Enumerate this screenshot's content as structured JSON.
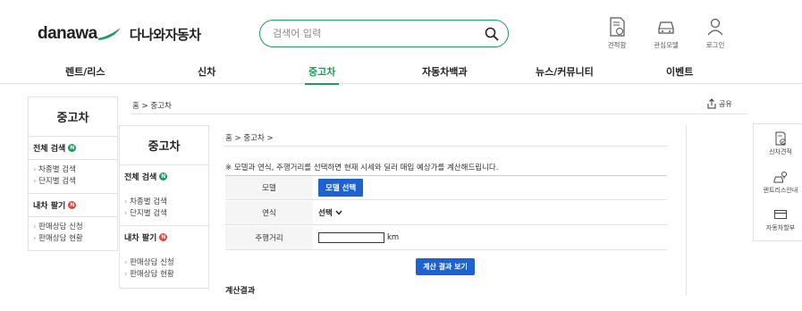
{
  "header": {
    "logo_en": "danawa",
    "logo_ko": "다나와자동차",
    "search_placeholder": "검색어 입력",
    "utils": [
      "견적함",
      "관심모델",
      "로그인"
    ]
  },
  "gnb": [
    "렌트/리스",
    "신차",
    "중고차",
    "자동차백과",
    "뉴스/커뮤니티",
    "이벤트"
  ],
  "sidebar": {
    "title": "중고차",
    "section1": "전체 검색",
    "section1_badge": "N",
    "section1_items": [
      "차종별 검색",
      "단지별 검색"
    ],
    "section2": "내차 팔기",
    "section2_badge": "N",
    "section2_items": [
      "판매상담 신청",
      "판매상담 현황"
    ]
  },
  "breadcrumb": {
    "home": "홈",
    "sep": ">",
    "current": "중고차",
    "inner": "홈 > 중고차 >"
  },
  "share": "공유",
  "form": {
    "notice": "※ 모델과 연식, 주행거리를 선택하면 현재 시세와 딜러 매입 예상가를 계산해드립니다.",
    "model_label": "모델",
    "model_button": "모델 선택",
    "year_label": "연식",
    "year_select": "선택",
    "mileage_label": "주행거리",
    "mileage_value": "",
    "mileage_unit": "km",
    "calc_button": "계산 결과 보기",
    "result_title": "계산결과"
  },
  "quick_menu": [
    "신차견적",
    "렌트리스안내",
    "자동차할부"
  ],
  "colors": {
    "accent": "#1c9c5a",
    "button_blue": "#1e62d0",
    "badge_red": "#e0443a"
  }
}
